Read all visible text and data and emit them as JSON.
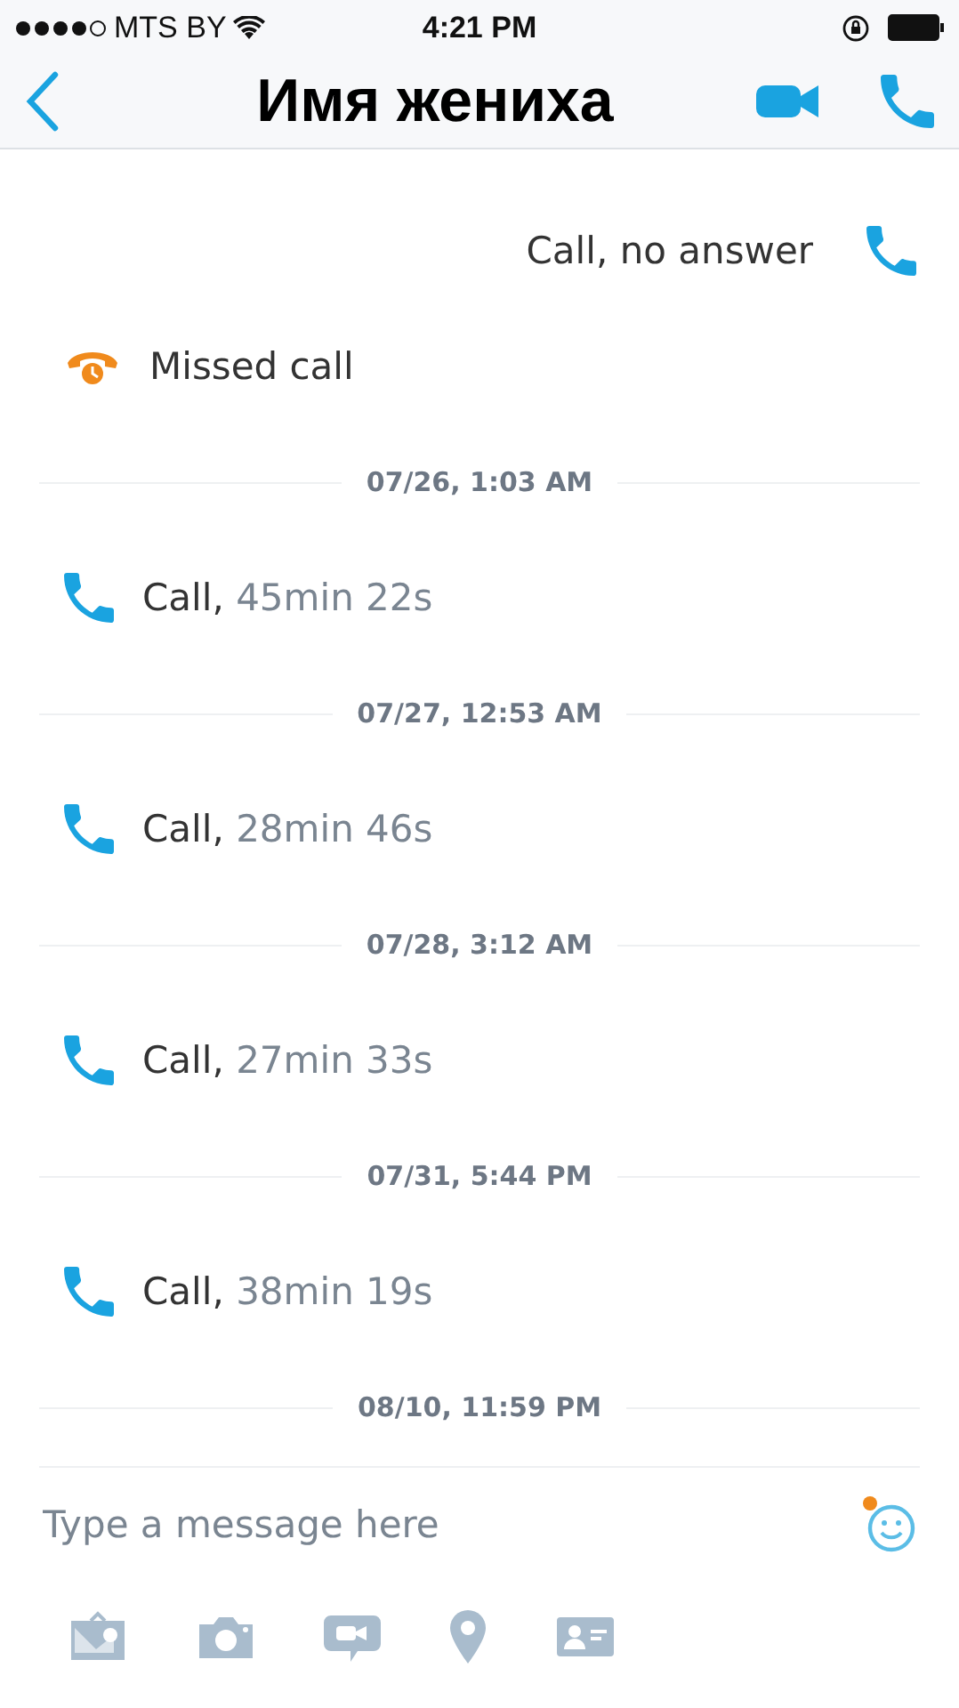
{
  "status_bar": {
    "carrier": "MTS BY",
    "time": "4:21 PM"
  },
  "header": {
    "title": "Имя жениха"
  },
  "messages": [
    {
      "kind": "outgoing",
      "text": "Call, no answer"
    },
    {
      "kind": "missed",
      "text": "Missed call"
    },
    {
      "kind": "date",
      "text": "07/26, 1:03 AM"
    },
    {
      "kind": "call",
      "text": "Call,",
      "duration": "45min 22s"
    },
    {
      "kind": "date",
      "text": "07/27, 12:53 AM"
    },
    {
      "kind": "call",
      "text": "Call,",
      "duration": "28min 46s"
    },
    {
      "kind": "date",
      "text": "07/28, 3:12 AM"
    },
    {
      "kind": "call",
      "text": "Call,",
      "duration": "27min 33s"
    },
    {
      "kind": "date",
      "text": "07/31, 5:44 PM"
    },
    {
      "kind": "call",
      "text": "Call,",
      "duration": "38min 19s"
    },
    {
      "kind": "date",
      "text": "08/10, 11:59 PM"
    }
  ],
  "compose": {
    "placeholder": "Type a message here"
  }
}
